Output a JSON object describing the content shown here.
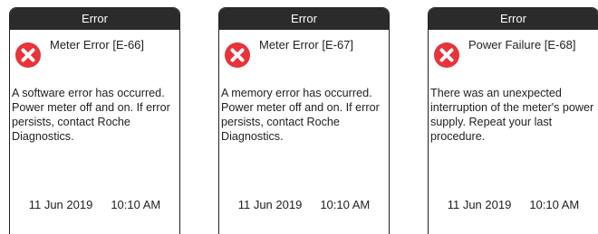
{
  "screens": [
    {
      "title": "Error",
      "heading": "Meter Error [E-66]",
      "message": "A software error has occurred. Power meter off and on. If error persists, contact Roche Diagnostics.",
      "date": "11 Jun 2019",
      "time": "10:10 AM",
      "icon": "error-x-icon"
    },
    {
      "title": "Error",
      "heading": "Meter Error [E-67]",
      "message": "A memory error has occurred. Power meter off and on. If error persists, contact Roche Diagnostics.",
      "date": "11 Jun 2019",
      "time": "10:10 AM",
      "icon": "error-x-icon"
    },
    {
      "title": "Error",
      "heading": "Power Failure [E-68]",
      "message": "There was an unexpected interruption of the meter's power supply. Repeat your last procedure.",
      "date": "11 Jun 2019",
      "time": "10:10 AM",
      "icon": "error-x-icon"
    }
  ],
  "colors": {
    "titlebar": "#2b2b2b",
    "error_icon": "#e8333a",
    "text": "#222222"
  }
}
